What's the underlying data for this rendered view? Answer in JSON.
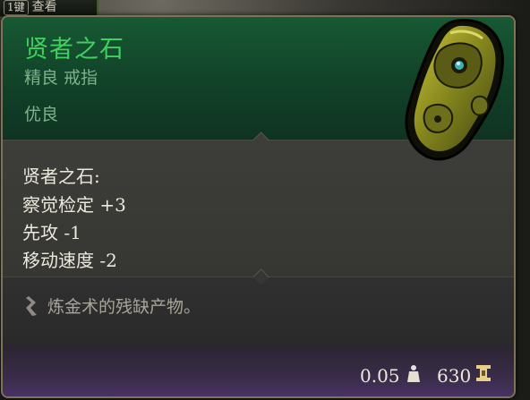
{
  "hotkey_bar": {
    "key": "1键",
    "label": "查看"
  },
  "item": {
    "name": "贤者之石",
    "type": "精良 戒指",
    "rarity": "优良",
    "stats": [
      "贤者之石:",
      "察觉检定 +3",
      "先攻 -1",
      "移动速度 -2"
    ],
    "description": "炼金术的残缺产物。",
    "weight": "0.05",
    "price": "630",
    "icon": "stone-amulet-icon"
  },
  "colors": {
    "name": "#3fd05e",
    "subtitle": "#7bb38a",
    "stats_text": "#ece8dc",
    "description": "#a8a49a",
    "border": "#7f7356"
  }
}
